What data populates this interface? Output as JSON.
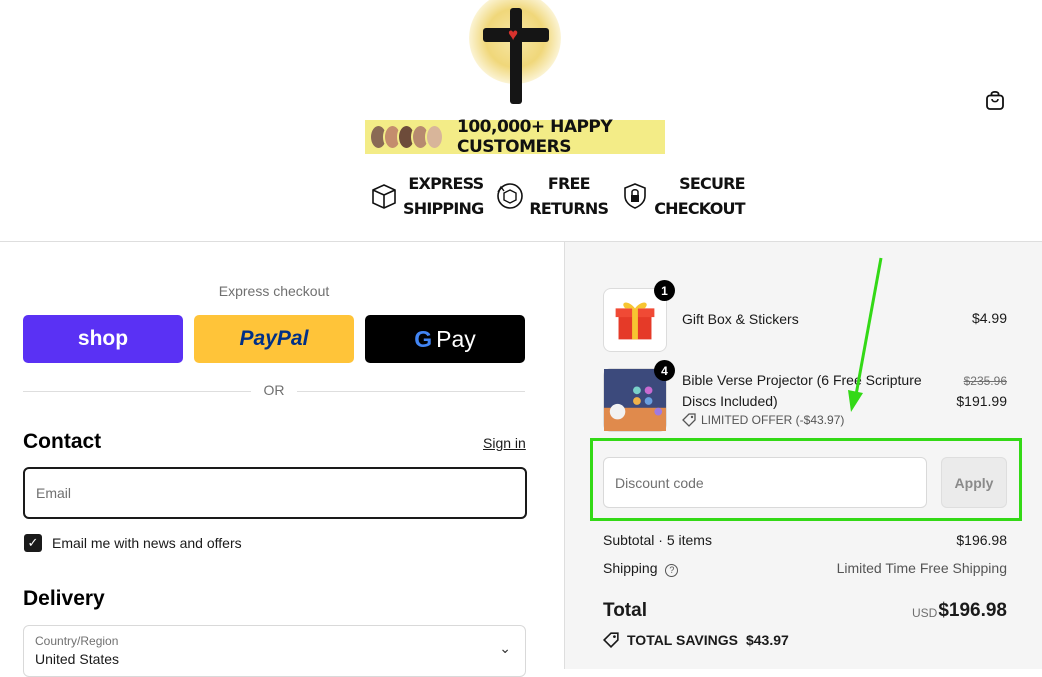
{
  "header": {
    "banner_text": "100,000+ HAPPY CUSTOMERS",
    "badges": [
      {
        "icon": "box-icon",
        "line1": "EXPRESS",
        "line2": "SHIPPING"
      },
      {
        "icon": "return-box-icon",
        "line1": "FREE",
        "line2": "RETURNS"
      },
      {
        "icon": "shield-lock-icon",
        "line1": "SECURE",
        "line2": "CHECKOUT"
      }
    ],
    "cart_icon": "shopping-bag-icon"
  },
  "checkout": {
    "express_label": "Express checkout",
    "shop_label": "shop",
    "paypal_label": "PayPal",
    "gpay_label": "Pay",
    "or_label": "OR",
    "contact_title": "Contact",
    "signin_label": "Sign in",
    "email_placeholder": "Email",
    "newsletter_label": "Email me with news and offers",
    "newsletter_checked": true,
    "delivery_title": "Delivery",
    "country_label": "Country/Region",
    "country_value": "United States"
  },
  "summary": {
    "items": [
      {
        "qty": "1",
        "name": "Gift Box & Stickers",
        "price": "$4.99"
      },
      {
        "qty": "4",
        "name_line1": "Bible Verse Projector (6 Free Scripture",
        "name_line2": "Discs Included)",
        "old_price": "$235.96",
        "price": "$191.99",
        "offer": "LIMITED OFFER (-$43.97)"
      }
    ],
    "discount_placeholder": "Discount code",
    "apply_label": "Apply",
    "subtotal_label": "Subtotal · 5 items",
    "subtotal_value": "$196.98",
    "shipping_label": "Shipping",
    "shipping_value": "Limited Time Free Shipping",
    "total_label": "Total",
    "total_currency": "USD",
    "total_value": "$196.98",
    "savings_label": "TOTAL SAVINGS",
    "savings_value": "$43.97"
  },
  "colors": {
    "shop_purple": "#5a31f4",
    "paypal_yellow": "#ffc439",
    "highlight_green": "#33d916"
  }
}
